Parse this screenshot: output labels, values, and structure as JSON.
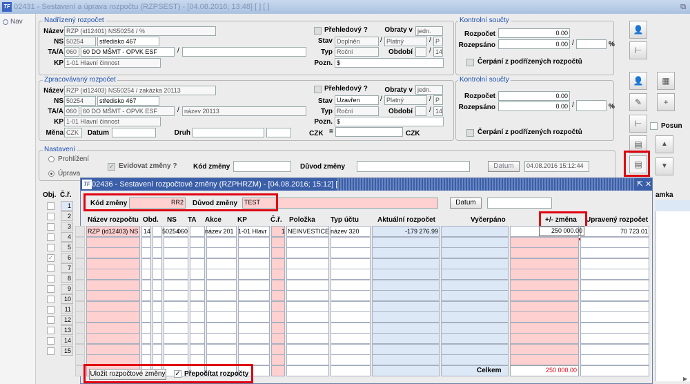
{
  "window": {
    "title": "02431 - Sestavení a úprava rozpočtu (RZPSEST) - [04.08.2016; 13:48]  [ ]  [ ]",
    "restore_icon": "⧉",
    "close_icon": "✕"
  },
  "nav": {
    "label": "Nav"
  },
  "nadrizeny": {
    "legend": "Nadřízený rozpočet",
    "nazev_lbl": "Název",
    "nazev": "RZP (id12401) NS50254 / %",
    "ns_lbl": "NS",
    "ns": "50254",
    "ns_name": "středisko 467",
    "taa_lbl": "TA/A",
    "ta": "060",
    "akce": "60 DO MŠMT - OPVK ESF",
    "akce2": "",
    "kp_lbl": "KP",
    "kp": "1-01 Hlavní činnost",
    "prehled_lbl": "Přehledový ?",
    "obraty_lbl": "Obraty v",
    "obraty": "jedn.",
    "stav_lbl": "Stav",
    "stav": "Doplněn",
    "stav2": "Platný",
    "stav3": "P",
    "typ_lbl": "Typ",
    "typ": "Roční",
    "obdobi_lbl": "Období",
    "obdobi": "",
    "obdobi2": "14",
    "pozn_lbl": "Pozn.",
    "pozn": "$"
  },
  "kontrolni1": {
    "legend": "Kontrolní součty",
    "rozpocet_lbl": "Rozpočet",
    "rozpocet": "0.00",
    "rozepsano_lbl": "Rozepsáno",
    "rozepsano": "0.00",
    "pct": "%",
    "cerpani_lbl": "Čerpání z podřízených rozpočtů"
  },
  "zpracovavany": {
    "legend": "Zpracovávaný rozpočet",
    "nazev_lbl": "Název",
    "nazev": "RZP (id12403) NS50254 / zakázka 20113",
    "ns_lbl": "NS",
    "ns": "50254",
    "ns_name": "středisko 467",
    "taa_lbl": "TA/A",
    "ta": "060",
    "akce": "60 DO MŠMT - OPVK ESF",
    "akce2": "název 20113",
    "kp_lbl": "KP",
    "kp": "1-01 Hlavní činnost",
    "mena_lbl": "Měna",
    "mena": "CZK",
    "datum_lbl": "Datum",
    "datum": "",
    "druh_lbl": "Druh",
    "druh": "",
    "prehled_lbl": "Přehledový ?",
    "obraty_lbl": "Obraty v",
    "obraty": "jedn.",
    "stav_lbl": "Stav",
    "stav": "Uzavřen",
    "stav2": "Platný",
    "stav3": "P",
    "typ_lbl": "Typ",
    "typ": "Roční",
    "obdobi_lbl": "Období",
    "obdobi2": "14",
    "pozn_lbl": "Pozn.",
    "pozn": "$",
    "czk1": "CZK",
    "eq": "=",
    "czk2": "CZK"
  },
  "kontrolni2": {
    "legend": "Kontrolní součty",
    "rozpocet_lbl": "Rozpočet",
    "rozpocet": "0.00",
    "rozepsano_lbl": "Rozepsáno",
    "rozepsano": "0.00",
    "pct": "%",
    "cerpani_lbl": "Čerpání z podřízených rozpočtů"
  },
  "nastaveni": {
    "legend": "Nastavení",
    "prohlizeni": "Prohlížení",
    "uprava": "Úprava",
    "evidovat_lbl": "Evidovat změny ?",
    "kod_lbl": "Kód změny",
    "duvod_lbl": "Důvod změny",
    "datum_btn": "Datum",
    "datum": "04.08.2016 15:12:44"
  },
  "right": {
    "posun": "Posun",
    "amka": "amka"
  },
  "list": {
    "obj": "Obj.",
    "cr": "Č.ř.",
    "rows": [
      "1",
      "2",
      "3",
      "4",
      "5",
      "6",
      "7",
      "8",
      "9",
      "10",
      "11",
      "12",
      "13",
      "14",
      "15"
    ]
  },
  "dialog": {
    "title": "02436 - Sestavení rozpočtové změny (RZPHRZM) - [04.08.2016; 15:12]  [ ]  [ ]",
    "kod_lbl": "Kód změny",
    "kod": "RR2",
    "duvod_lbl": "Důvod změny",
    "duvod": "TEST",
    "datum_btn": "Datum",
    "datum": "",
    "headers": [
      "Název rozpočtu",
      "Obd.",
      "NS",
      "TA",
      "Akce",
      "KP",
      "Č.ř.",
      "Položka",
      "Typ účtu",
      "Aktuální rozpočet",
      "Vyčerpáno",
      "+/- změna",
      "Upravený rozpočet"
    ],
    "row1": [
      "RZP (id12403) NS",
      "14",
      "50254",
      "060",
      "název 201",
      "1-01 Hlavr",
      "1",
      "NEINVESTICE",
      "název 320",
      "-179 276.99",
      "",
      "250 000.00",
      "70 723.01"
    ],
    "save_btn": "Uložit rozpočtové změny",
    "prepocitat_lbl": "Přepočítat rozpočty",
    "celkem_lbl": "Celkem",
    "celkem": "250 000.00"
  }
}
